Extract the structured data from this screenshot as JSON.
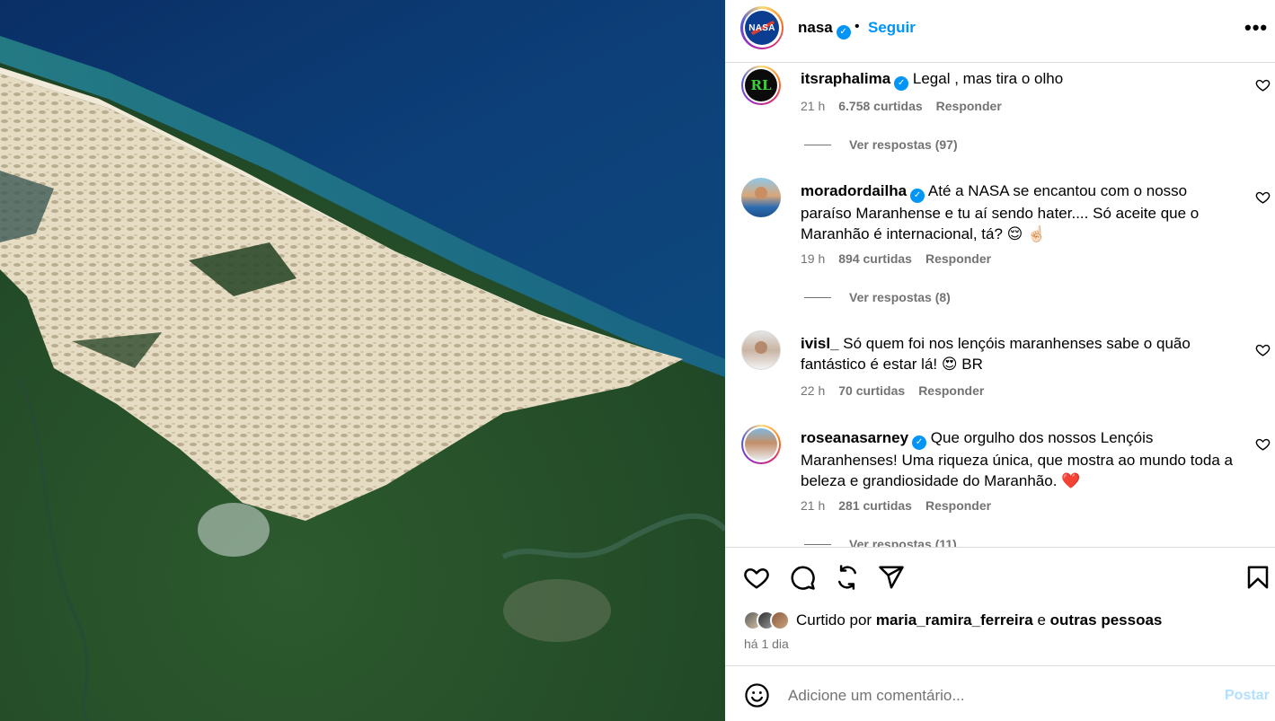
{
  "post": {
    "account": "nasa",
    "avatar_text": "NASA",
    "follow_label": "Seguir",
    "separator": "•",
    "more_label": "•••"
  },
  "comments": [
    {
      "user": "itsraphalima",
      "verified": true,
      "avatar_text": "RL",
      "text": "Legal , mas tira o olho",
      "time": "21 h",
      "likes": "6.758 curtidas",
      "reply_label": "Responder",
      "replies_label": "Ver respostas (97)"
    },
    {
      "user": "moradordailha",
      "verified": true,
      "text": "Até a NASA se encantou com o nosso paraíso Maranhense e tu aí sendo hater.... Só aceite que o Maranhão é internacional, tá? 😌 ☝🏻",
      "time": "19 h",
      "likes": "894 curtidas",
      "reply_label": "Responder",
      "replies_label": "Ver respostas (8)"
    },
    {
      "user": "ivisl_",
      "verified": false,
      "text": "Só quem foi nos lençóis maranhenses sabe o quão fantástico é estar lá! 😍 BR",
      "time": "22 h",
      "likes": "70 curtidas",
      "reply_label": "Responder"
    },
    {
      "user": "roseanasarney",
      "verified": true,
      "text": "Que orgulho dos nossos Lençóis Maranhenses! Uma riqueza única, que mostra ao mundo toda a beleza e grandiosidade do Maranhão. ❤️",
      "time": "21 h",
      "likes": "281 curtidas",
      "reply_label": "Responder",
      "replies_label": "Ver respostas (11)"
    }
  ],
  "liked_by": {
    "prefix": "Curtido por",
    "user": "maria_ramira_ferreira",
    "conj": "e",
    "others": "outras pessoas"
  },
  "posted_time": "há 1 dia",
  "add_comment": {
    "placeholder": "Adicione um comentário...",
    "post_label": "Postar"
  },
  "colors": {
    "accent": "#0095f6",
    "post_disabled": "#b2dffc",
    "muted": "#737373",
    "border": "#dbdbdb"
  }
}
